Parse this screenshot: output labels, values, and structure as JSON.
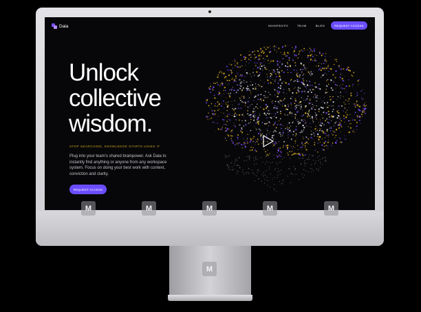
{
  "site": {
    "logo_text": "Dala",
    "nav": [
      {
        "label": "MANIFESTO"
      },
      {
        "label": "TEAM"
      },
      {
        "label": "BLOG"
      }
    ],
    "nav_cta": "REQUEST ACCESS",
    "hero": {
      "headline": [
        "Unlock",
        "collective",
        "wisdom."
      ],
      "eyebrow": "STOP SEARCHING, KNOWLEDGE STARTS USING IT",
      "body": "Plug into your team's shared brainpower. Ask Dala to instantly find anything or anyone from any workspace system. Focus on doing your best work with context, conviction and clarity.",
      "cta": "REQUEST ACCESS"
    }
  },
  "watermark_letter": "M",
  "colors": {
    "accent": "#6b4dff",
    "eyebrow": "#c9a227",
    "brain_gold": "#e5b420",
    "brain_purple": "#7b4bff",
    "brain_white": "#e8e8ee",
    "frame": "#d8d8dc",
    "screen_bg": "#070709"
  },
  "icons": {
    "logo": "dala-logo-icon",
    "hero_image": "particle-brain-image",
    "play": "play-triangle-icon"
  }
}
